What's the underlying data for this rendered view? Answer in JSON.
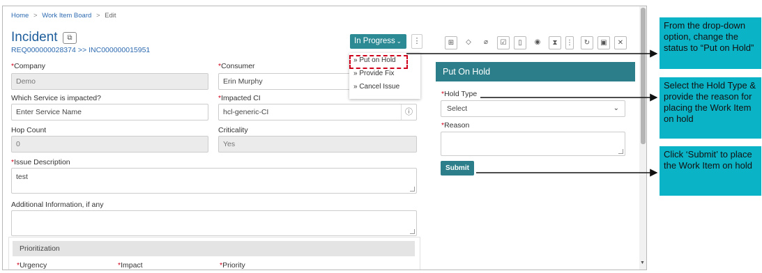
{
  "breadcrumb": {
    "home": "Home",
    "board": "Work Item Board",
    "current": "Edit",
    "separator": ">"
  },
  "header": {
    "title": "Incident",
    "req_id": "REQ000000028374",
    "link_arrow": ">>",
    "inc_id": "INC000000015951",
    "status_label": "In Progress",
    "more_glyph": "⋮"
  },
  "status_menu": {
    "items": [
      {
        "label": "» Put on Hold"
      },
      {
        "label": "» Provide Fix"
      },
      {
        "label": "» Cancel Issue"
      }
    ]
  },
  "form": {
    "company": {
      "label": "Company",
      "value": "Demo"
    },
    "consumer": {
      "label": "Consumer",
      "value": "Erin Murphy"
    },
    "service": {
      "label": "Which Service is impacted?",
      "placeholder": "Enter Service Name"
    },
    "impacted_ci": {
      "label": "Impacted CI",
      "value": "hcl-generic-CI"
    },
    "hop_count": {
      "label": "Hop Count",
      "value": "0"
    },
    "criticality": {
      "label": "Criticality",
      "value": "Yes"
    },
    "issue_description": {
      "label": "Issue Description",
      "value": "test"
    },
    "additional_info": {
      "label": "Additional Information, if any",
      "value": ""
    },
    "prioritization": {
      "label": "Prioritization"
    },
    "urgency": {
      "label": "Urgency"
    },
    "impact": {
      "label": "Impact"
    },
    "priority": {
      "label": "Priority"
    },
    "required_mark": "*"
  },
  "hold_panel": {
    "title": "Put On Hold",
    "hold_type_label": "Hold Type",
    "hold_type_value": "Select",
    "reason_label": "Reason",
    "reason_value": "",
    "submit_label": "Submit"
  },
  "callouts": [
    {
      "text": "From the drop-down option, change the status to “Put on Hold”"
    },
    {
      "text": "Select the Hold Type & provide the reason for placing the Work Item on hold"
    },
    {
      "text": "Click ‘Submit’ to place the Work Item on hold"
    }
  ],
  "colors": {
    "accent": "#2c8a95",
    "panel_header": "#2c7f8a",
    "callout_bg": "#0bb3c7",
    "required": "#d0021b",
    "link": "#2d6ab0"
  }
}
